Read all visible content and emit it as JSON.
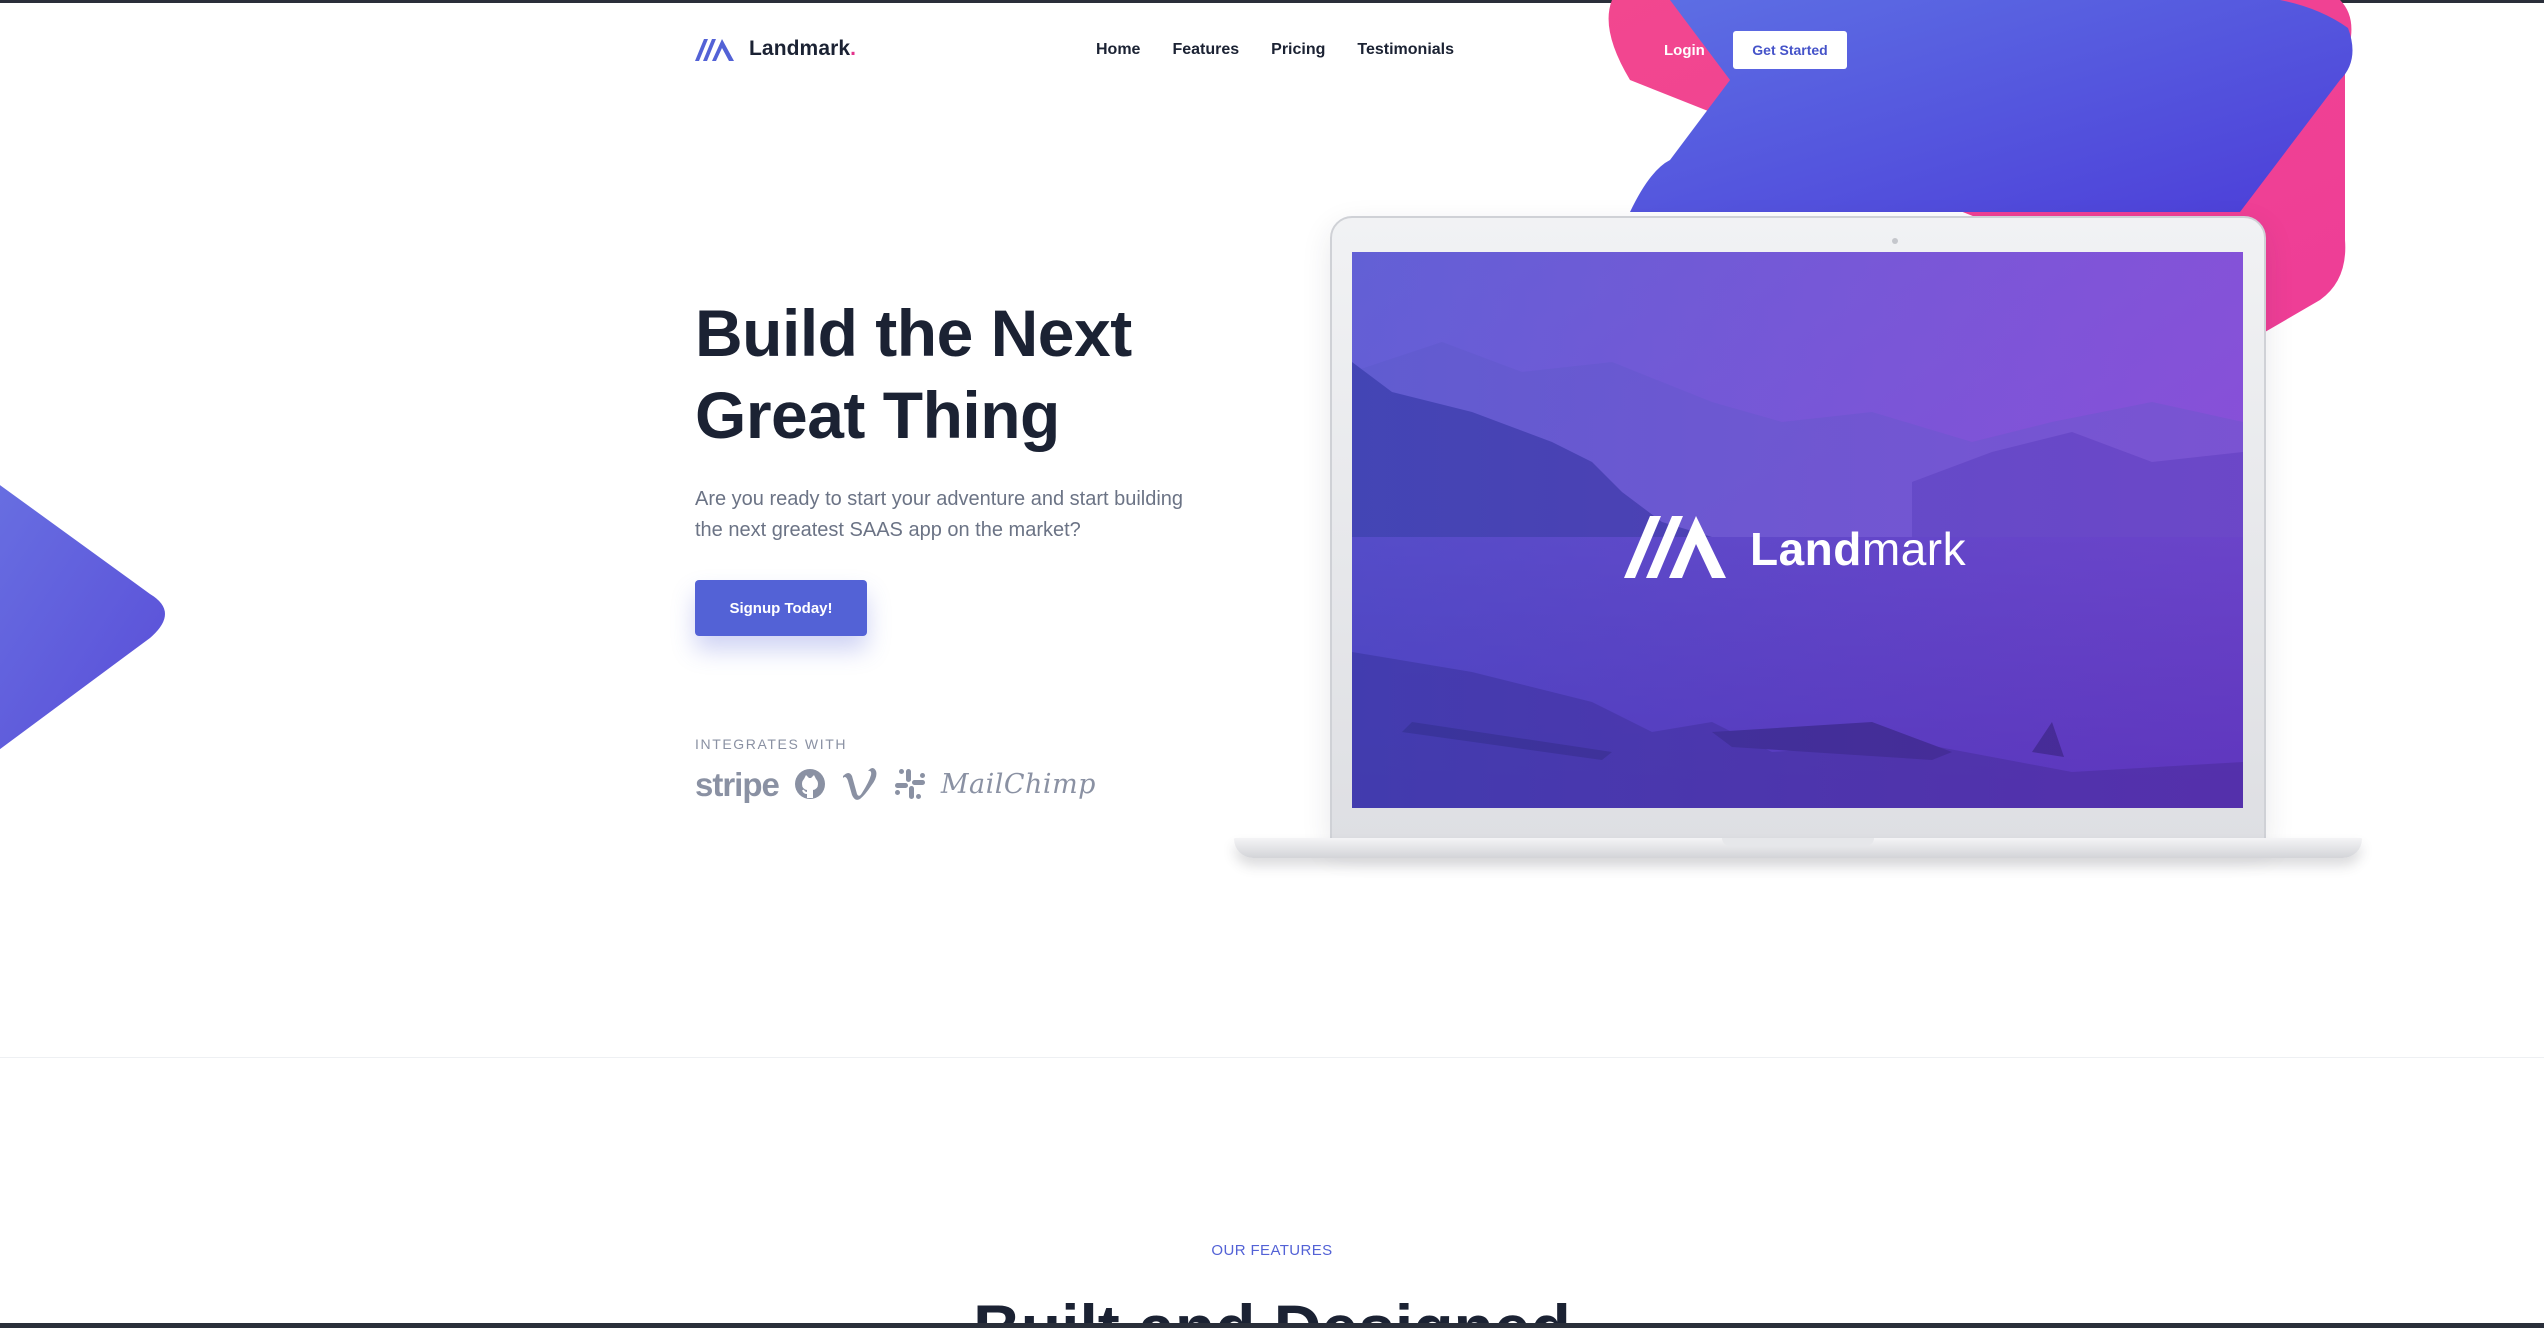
{
  "brand": {
    "name": "Landmark",
    "dot": ".",
    "accent_color": "#5362d6",
    "pink_color": "#ee3d97"
  },
  "nav": {
    "items": [
      "Home",
      "Features",
      "Pricing",
      "Testimonials"
    ],
    "login_label": "Login",
    "get_started_label": "Get Started"
  },
  "hero": {
    "title_line1": "Build the Next",
    "title_line2": "Great Thing",
    "subtitle": "Are you ready to start your adventure and start building the next greatest SAAS app on the market?",
    "cta_label": "Signup Today!"
  },
  "integrations": {
    "label": "INTEGRATES WITH",
    "stripe": "stripe",
    "mailchimp": "MailChimp",
    "icons": [
      "stripe-logo",
      "github-icon",
      "vimeo-icon",
      "slack-icon",
      "mailchimp-logo"
    ]
  },
  "screen": {
    "logo_text_bold": "Land",
    "logo_text_light": "mark"
  },
  "features": {
    "label": "OUR FEATURES",
    "title": "Built and Designed"
  }
}
